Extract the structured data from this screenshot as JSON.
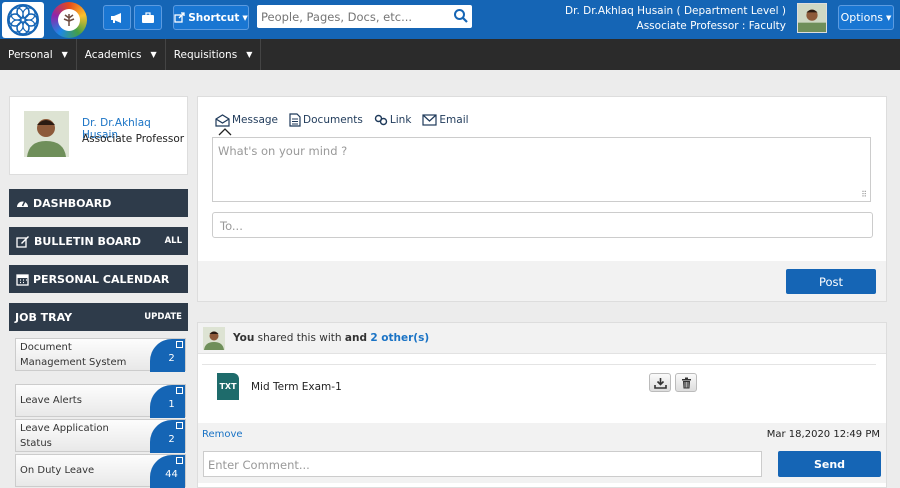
{
  "topbar": {
    "shortcut_label": "Shortcut",
    "search_placeholder": "People, Pages, Docs, etc...",
    "user_name": "Dr. Dr.Akhlaq Husain ( Department Level )",
    "user_role": "Associate Professor : Faculty",
    "options_label": "Options"
  },
  "menu": [
    {
      "label": "Personal"
    },
    {
      "label": "Academics"
    },
    {
      "label": "Requisitions"
    }
  ],
  "profile": {
    "name": "Dr. Dr.Akhlaq Husain",
    "role": "Associate Professor"
  },
  "sidebar": {
    "dashboard": "DASHBOARD",
    "bulletin": "BULLETIN BOARD",
    "bulletin_action": "ALL",
    "calendar": "PERSONAL CALENDAR",
    "jobtray": "JOB TRAY",
    "jobtray_action": "UPDATE"
  },
  "jobs": [
    {
      "label": "Document Management System",
      "count": "2"
    },
    {
      "label": "Leave Alerts",
      "count": "1"
    },
    {
      "label": "Leave Application Status",
      "count": "2"
    },
    {
      "label": "On Duty Leave",
      "count": "44"
    }
  ],
  "composer": {
    "tabs": [
      "Message",
      "Documents",
      "Link",
      "Email"
    ],
    "placeholder": "What's on your mind ?",
    "to_placeholder": "To...",
    "post_label": "Post"
  },
  "feed": {
    "you": "You",
    "shared_text": " shared this with ",
    "and": "and",
    "others": "2 other(s)",
    "file_type": "TXT",
    "file_name": "Mid Term Exam-1",
    "remove_label": "Remove",
    "date": "Mar 18,2020 12:49 PM",
    "comment_placeholder": "Enter Comment...",
    "send_label": "Send"
  },
  "colors": {
    "brand": "#1565b5",
    "menubar": "#2b2b2b",
    "sidebar_box": "#2e3b4a"
  }
}
